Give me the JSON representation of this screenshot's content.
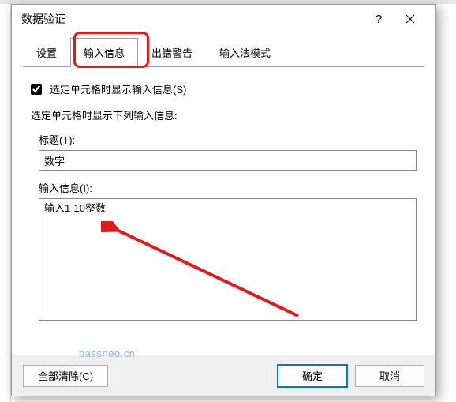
{
  "dialog": {
    "title": "数据验证",
    "help_tooltip": "?",
    "close_tooltip": "×"
  },
  "tabs": {
    "items": [
      {
        "label": "设置"
      },
      {
        "label": "输入信息"
      },
      {
        "label": "出错警告"
      },
      {
        "label": "输入法模式"
      }
    ],
    "active_index": 1
  },
  "content": {
    "checkbox_label": "选定单元格时显示输入信息(S)",
    "checkbox_checked": true,
    "section_label": "选定单元格时显示下列输入信息:",
    "title_field": {
      "label": "标题(T):",
      "value": "数字"
    },
    "message_field": {
      "label": "输入信息(I):",
      "value": "输入1-10整数"
    }
  },
  "footer": {
    "clear_all": "全部清除(C)",
    "ok": "确定",
    "cancel": "取消"
  },
  "watermark": "passneo.cn",
  "annotation": {
    "highlight_color": "#e11b1b",
    "arrow_color": "#e11b1b"
  }
}
